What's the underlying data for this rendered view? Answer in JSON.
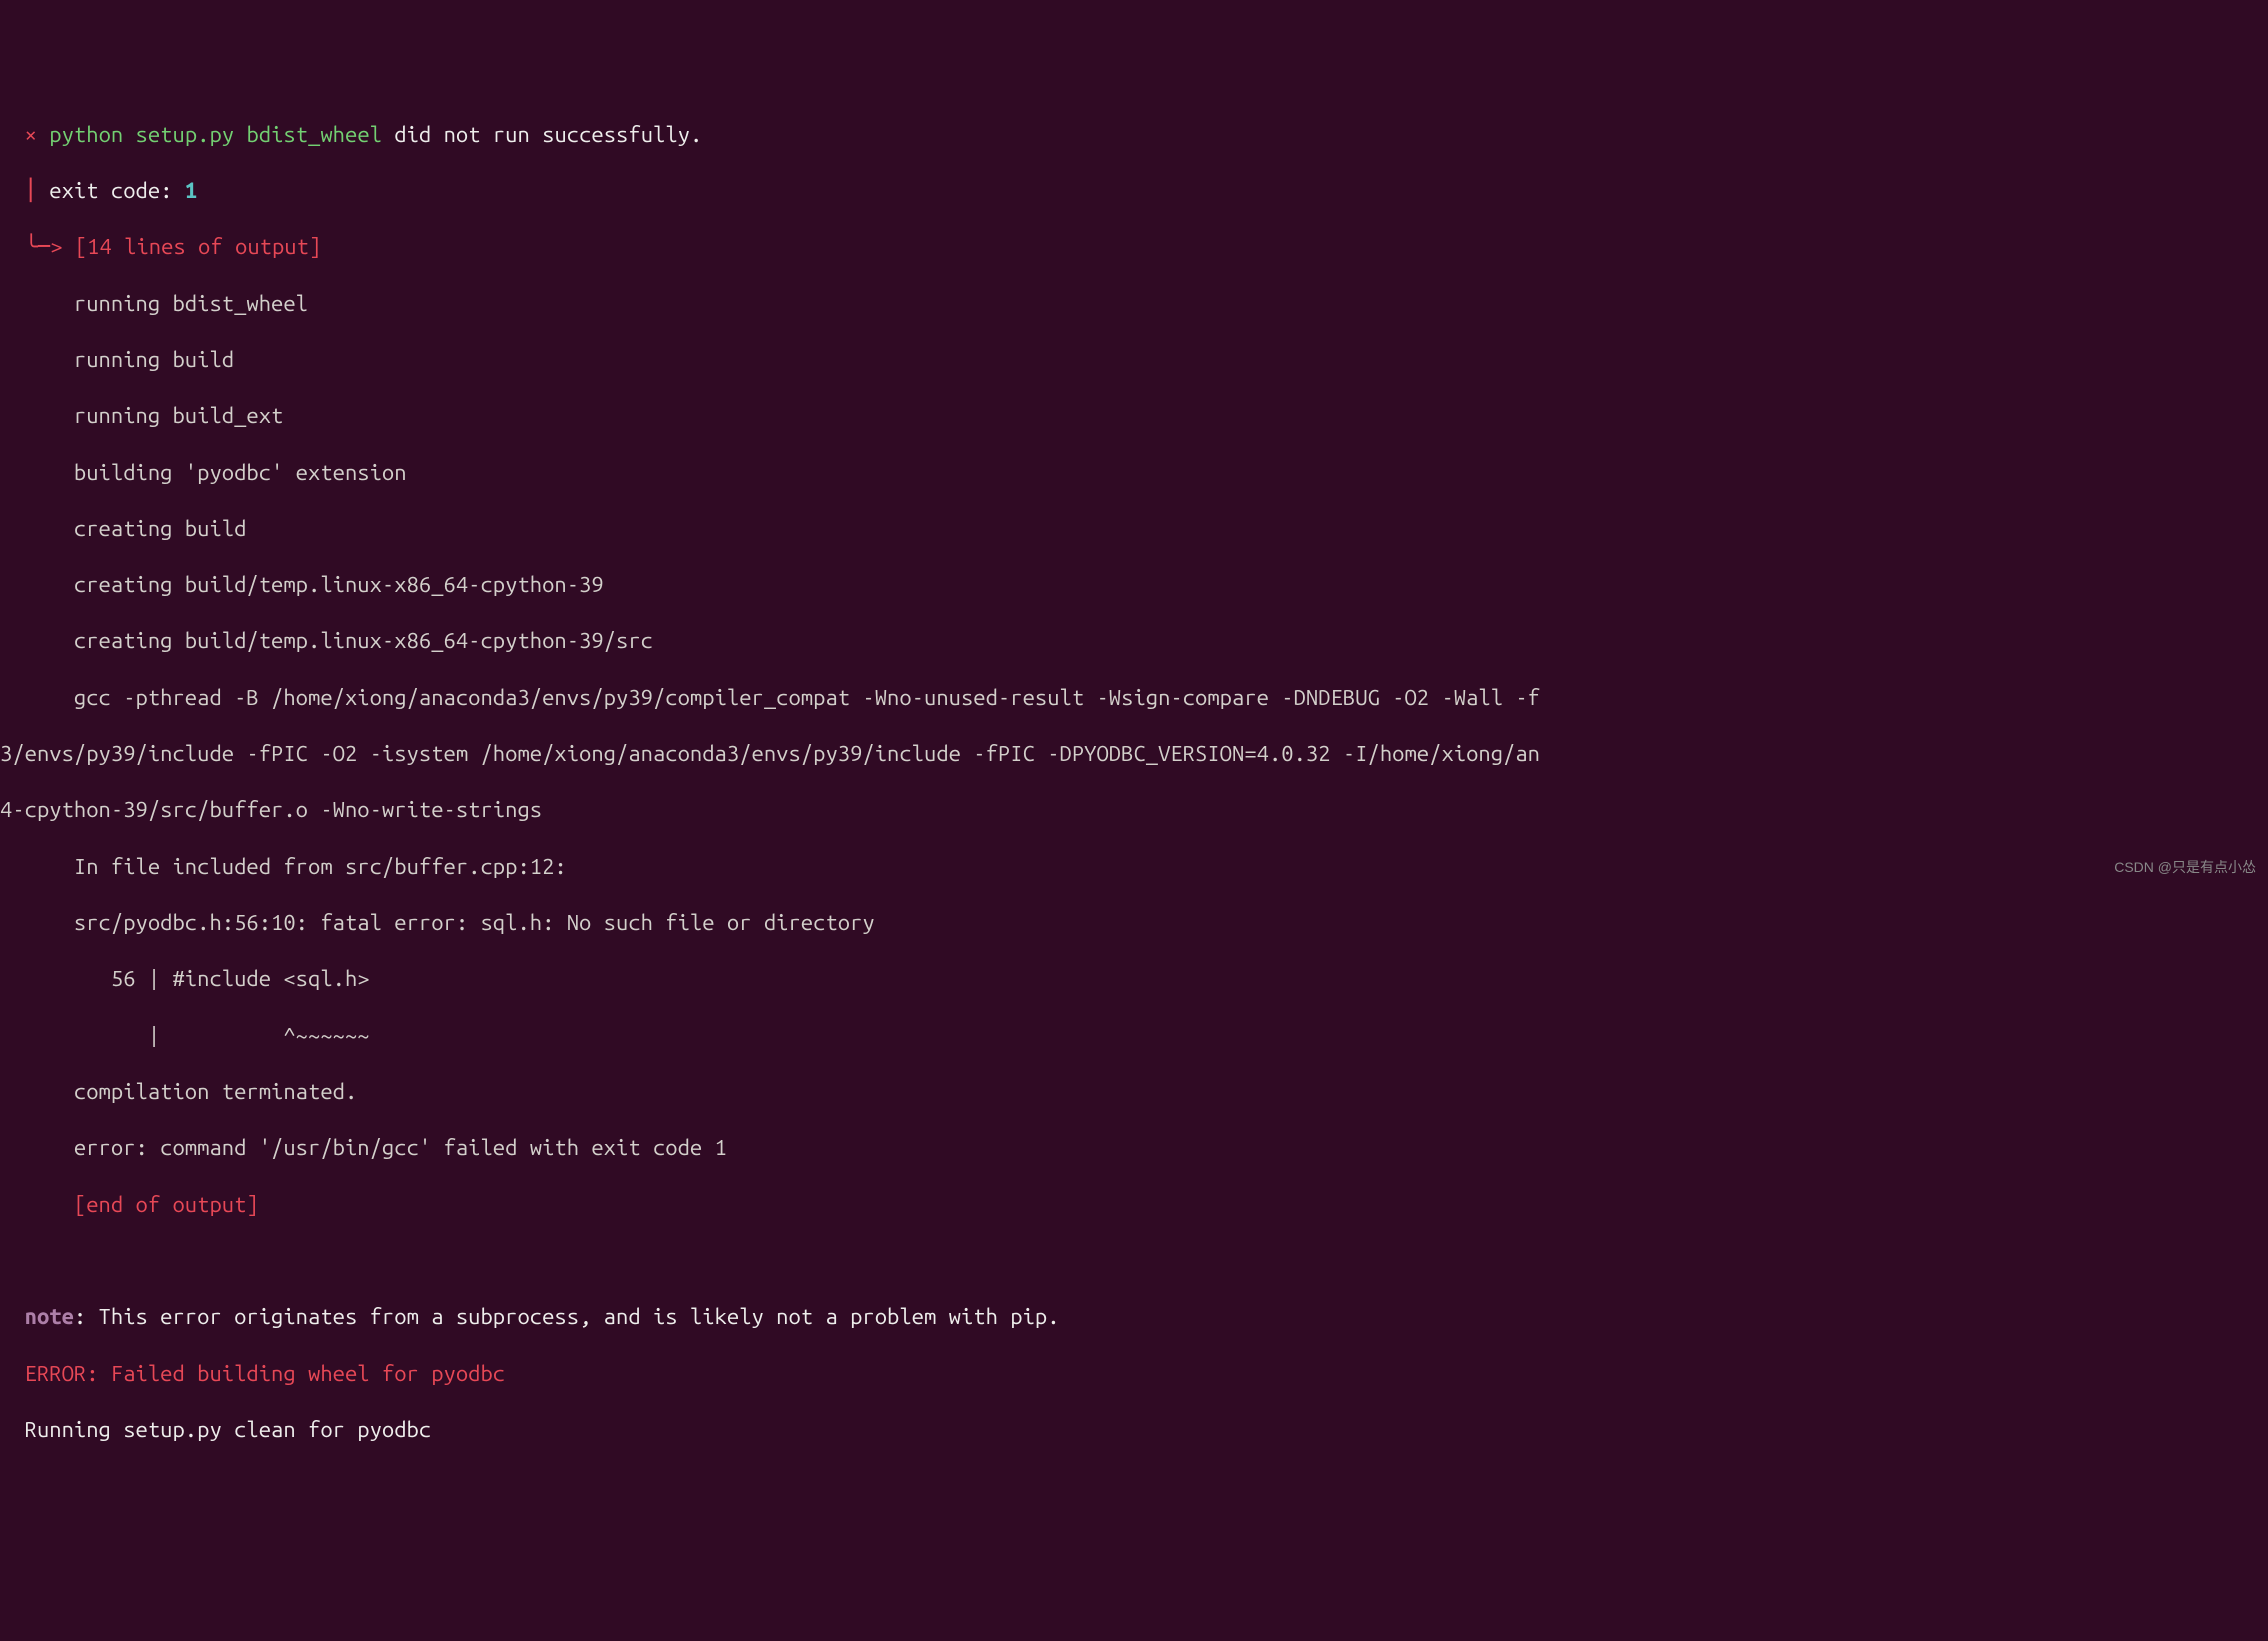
{
  "header": {
    "x": "×",
    "cmd_python": "python",
    "cmd_setup": "setup.py",
    "cmd_bdist": "bdist_wheel",
    "did_not_run": " did not run successfully.",
    "pipe": "│",
    "exit_code_label": "exit code: ",
    "exit_code": "1",
    "arrow": "╰─>",
    "lines_output": "[14 lines of output]"
  },
  "output": {
    "l1": "running bdist_wheel",
    "l2": "running build",
    "l3": "running build_ext",
    "l4": "building 'pyodbc' extension",
    "l5": "creating build",
    "l6": "creating build/temp.linux-x86_64-cpython-39",
    "l7": "creating build/temp.linux-x86_64-cpython-39/src",
    "l8": "gcc -pthread -B /home/xiong/anaconda3/envs/py39/compiler_compat -Wno-unused-result -Wsign-compare -DNDEBUG -O2 -Wall -f",
    "l8b": "3/envs/py39/include -fPIC -O2 -isystem /home/xiong/anaconda3/envs/py39/include -fPIC -DPYODBC_VERSION=4.0.32 -I/home/xiong/an",
    "l8c": "4-cpython-39/src/buffer.o -Wno-write-strings",
    "l9": "In file included from src/buffer.cpp:12:",
    "l10": "src/pyodbc.h:56:10: fatal error: sql.h: No such file or directory",
    "l11": "   56 | #include <sql.h>",
    "l12": "      |          ^~~~~~~",
    "l13": "compilation terminated.",
    "l14": "error: command '/usr/bin/gcc' failed with exit code 1",
    "end": "[end of output]"
  },
  "footer": {
    "note_label": "note",
    "note_text": ": This error originates from a subprocess, and is likely not a problem with pip.",
    "error": "ERROR: Failed building wheel for pyodbc",
    "running": "Running setup.py clean for pyodbc"
  },
  "watermark": "CSDN @只是有点小怂"
}
